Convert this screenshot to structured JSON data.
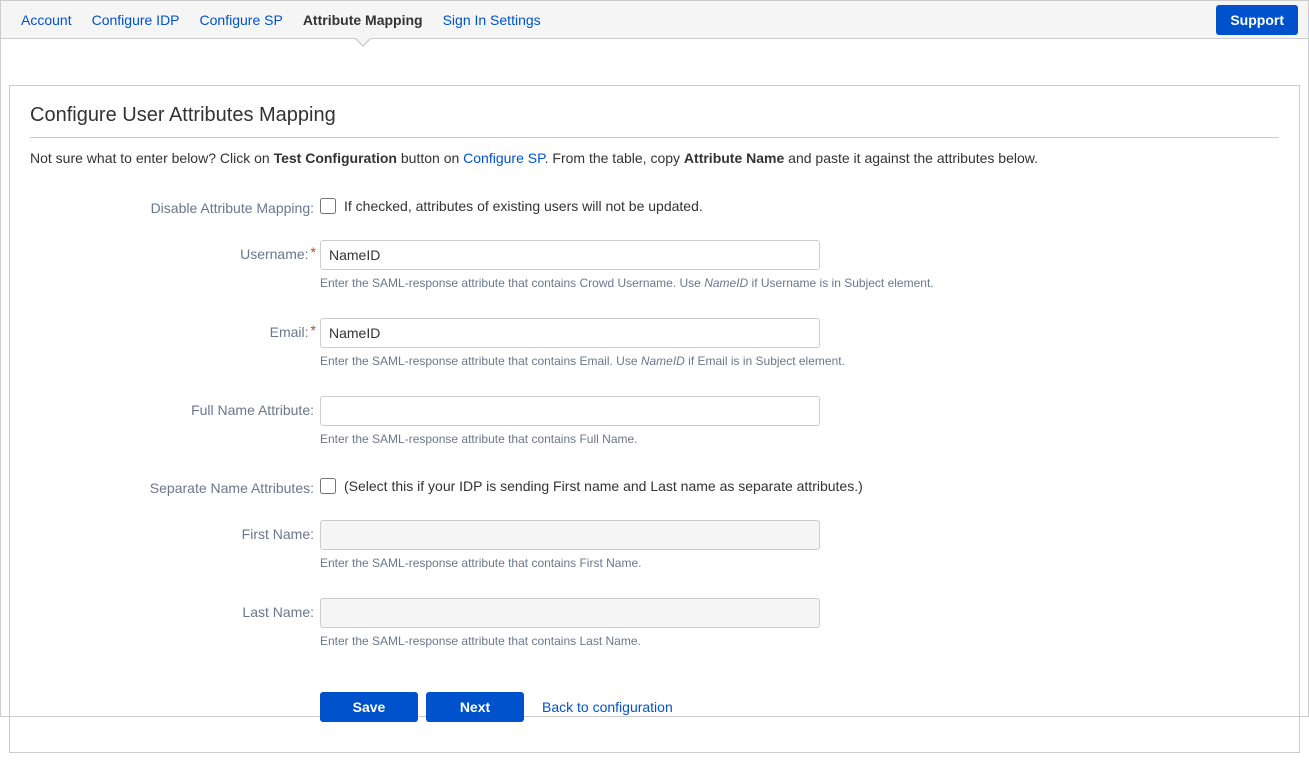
{
  "tabs": {
    "account": "Account",
    "configure_idp": "Configure IDP",
    "configure_sp": "Configure SP",
    "attribute_mapping": "Attribute Mapping",
    "sign_in_settings": "Sign In Settings"
  },
  "support_label": "Support",
  "panel_title": "Configure User Attributes Mapping",
  "hint": {
    "part1": "Not sure what to enter below? Click on ",
    "strong1": "Test Configuration",
    "part2": " button on ",
    "link": "Configure SP",
    "part3": ". From the table, copy ",
    "strong2": "Attribute Name",
    "part4": " and paste it against the attributes below."
  },
  "labels": {
    "disable_mapping": "Disable Attribute Mapping:",
    "username": "Username:",
    "email": "Email:",
    "full_name": "Full Name Attribute:",
    "separate_names": "Separate Name Attributes:",
    "first_name": "First Name:",
    "last_name": "Last Name:"
  },
  "checkbox_text": {
    "disable_mapping": "If checked, attributes of existing users will not be updated.",
    "separate_names": "(Select this if your IDP is sending First name and Last name as separate attributes.)"
  },
  "field_values": {
    "username": "NameID",
    "email": "NameID",
    "full_name": "",
    "first_name": "",
    "last_name": ""
  },
  "help": {
    "username_a": "Enter the SAML-response attribute that contains Crowd Username. Use ",
    "username_em": "NameID",
    "username_b": " if Username is in Subject element.",
    "email_a": "Enter the SAML-response attribute that contains Email. Use ",
    "email_em": "NameID",
    "email_b": " if Email is in Subject element.",
    "full_name": "Enter the SAML-response attribute that contains Full Name.",
    "first_name": "Enter the SAML-response attribute that contains First Name.",
    "last_name": "Enter the SAML-response attribute that contains Last Name."
  },
  "buttons": {
    "save": "Save",
    "next": "Next",
    "back": "Back to configuration"
  }
}
